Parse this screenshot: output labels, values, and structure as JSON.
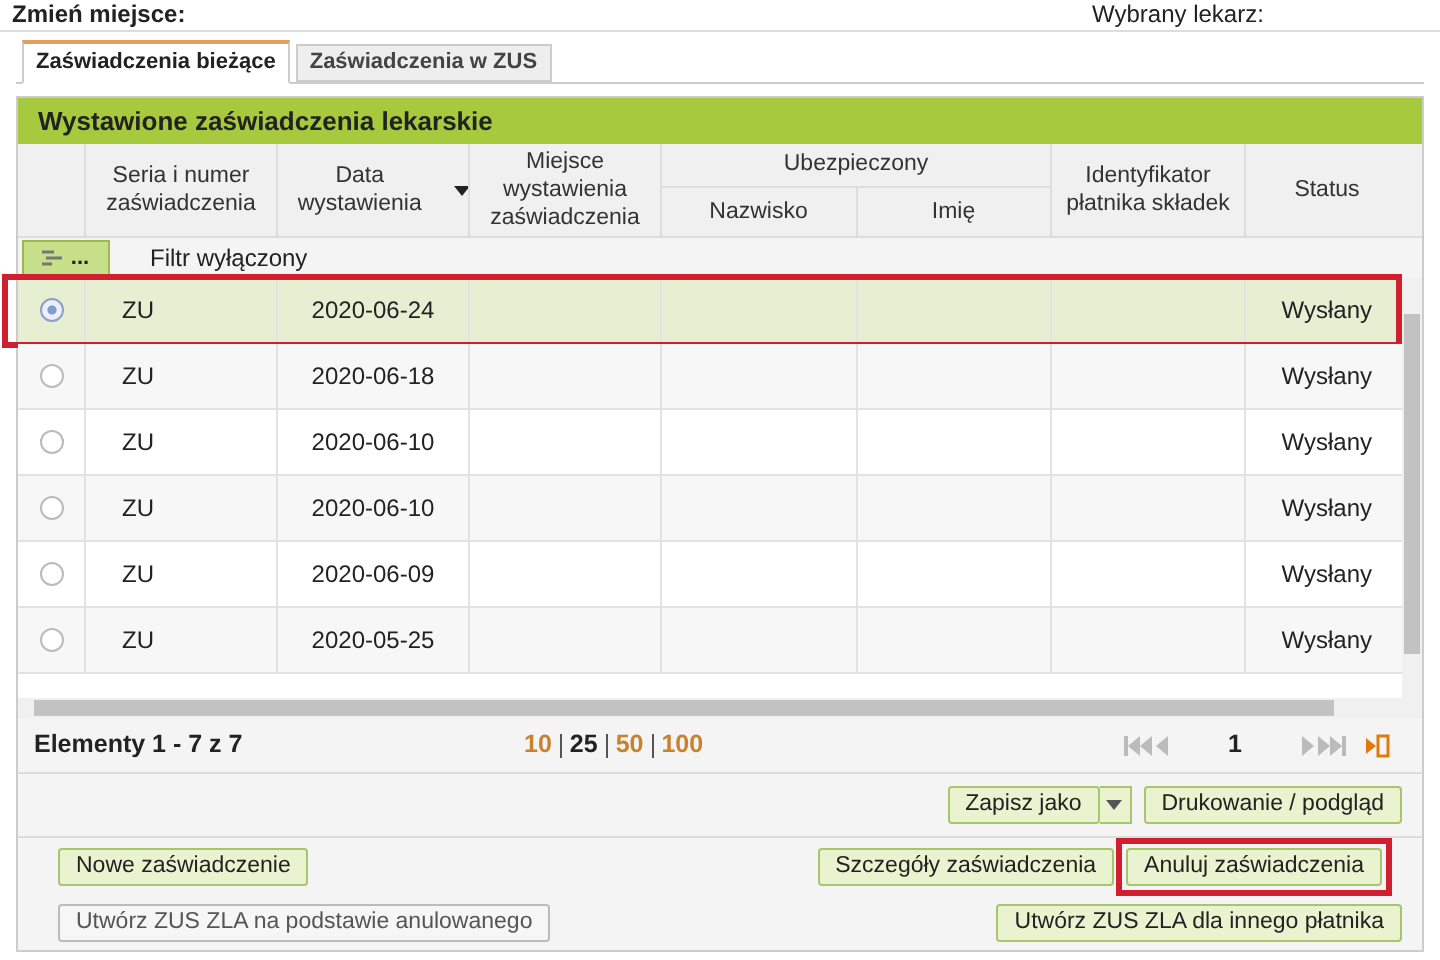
{
  "top_bar": {
    "place_label": "Zmień miejsce:",
    "doctor_label": "Wybrany lekarz:"
  },
  "tabs": [
    {
      "label": "Zaświadczenia bieżące",
      "selected": true
    },
    {
      "label": "Zaświadczenia w ZUS",
      "selected": false
    }
  ],
  "panel_title": "Wystawione zaświadczenia lekarskie",
  "columns": {
    "series": "Seria i numer zaświadczenia",
    "date": "Data wystawienia",
    "place": "Miejsce wystawienia zaświadczenia",
    "insured": "Ubezpieczony",
    "surname": "Nazwisko",
    "first_name": "Imię",
    "payer": "Identyfikator płatnika składek",
    "status": "Status"
  },
  "filter": {
    "button": "...",
    "label": "Filtr wyłączony"
  },
  "rows": [
    {
      "series": "ZU",
      "date": "2020-06-24",
      "status": "Wysłany",
      "selected": true,
      "highlighted": true
    },
    {
      "series": "ZU",
      "date": "2020-06-18",
      "status": "Wysłany",
      "selected": false,
      "highlighted": false
    },
    {
      "series": "ZU",
      "date": "2020-06-10",
      "status": "Wysłany",
      "selected": false,
      "highlighted": false
    },
    {
      "series": "ZU",
      "date": "2020-06-10",
      "status": "Wysłany",
      "selected": false,
      "highlighted": false
    },
    {
      "series": "ZU",
      "date": "2020-06-09",
      "status": "Wysłany",
      "selected": false,
      "highlighted": false
    },
    {
      "series": "ZU",
      "date": "2020-05-25",
      "status": "Wysłany",
      "selected": false,
      "highlighted": false
    }
  ],
  "pager": {
    "summary": "Elementy 1 - 7 z 7",
    "sizes": [
      {
        "label": "10",
        "selected": false
      },
      {
        "label": "25",
        "selected": true
      },
      {
        "label": "50",
        "selected": false
      },
      {
        "label": "100",
        "selected": false
      }
    ],
    "page": "1"
  },
  "toolbar_buttons": [
    {
      "label": "Zapisz jako",
      "kind": "split"
    },
    {
      "label": "Drukowanie / podgląd",
      "kind": "plain"
    }
  ],
  "action_buttons": [
    {
      "label": "Nowe zaświadczenie",
      "highlighted": false,
      "disabled": false
    },
    {
      "label": "Szczegóły zaświadczenia",
      "highlighted": false,
      "disabled": false
    },
    {
      "label": "Anuluj zaświadczenia",
      "highlighted": true,
      "disabled": false
    }
  ],
  "bottom_buttons": [
    {
      "label": "Utwórz ZUS ZLA na podstawie anulowanego",
      "disabled": true
    },
    {
      "label": "Utwórz ZUS ZLA dla innego płatnika",
      "disabled": false
    }
  ]
}
